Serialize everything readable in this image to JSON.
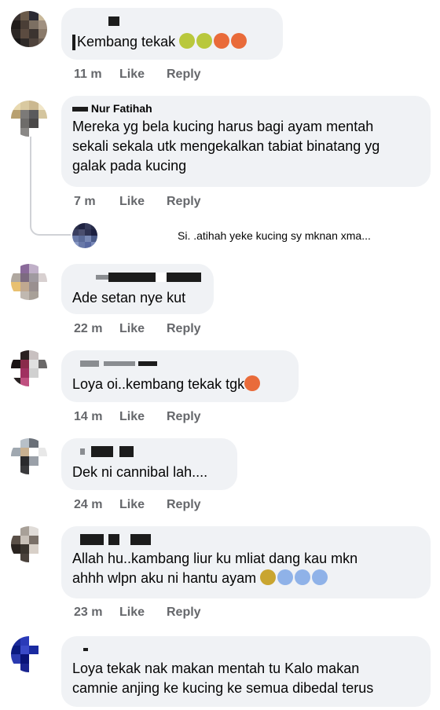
{
  "actions": {
    "like": "Like",
    "reply": "Reply"
  },
  "comments": [
    {
      "name": "",
      "text": [
        "Kembang tekak"
      ],
      "time": "11 m",
      "emojis": [
        "green",
        "green",
        "angry",
        "angry"
      ]
    },
    {
      "name": "Nur Fatihah",
      "text": [
        "Mereka yg bela kucing harus bagi ayam mentah",
        "sekali sekala utk mengekalkan tabiat binatang yg",
        "galak pada kucing"
      ],
      "time": "7 m"
    },
    {
      "name": "",
      "text": [
        "Ade setan nye kut"
      ],
      "time": "22 m"
    },
    {
      "name": "",
      "text": [
        "Loya oi..kembang tekak tgk"
      ],
      "time": "14 m",
      "emojis": [
        "angry"
      ]
    },
    {
      "name": "",
      "text": [
        "Dek ni cannibal lah...."
      ],
      "time": "24 m"
    },
    {
      "name": "",
      "text": [
        "Allah hu..kambang liur ku mliat dang kau mkn",
        "ahhh wlpn aku ni hantu ayam"
      ],
      "time": "23 m",
      "emojis": [
        "fear",
        "scream",
        "scream",
        "scream"
      ]
    },
    {
      "name": "",
      "text": [
        "Loya tekak nak makan mentah tu Kalo makan",
        "camnie anjing ke kucing ke semua dibedal terus"
      ]
    }
  ],
  "reply_preview": "Si.      .atihah yeke kucing sy mknan xma..."
}
